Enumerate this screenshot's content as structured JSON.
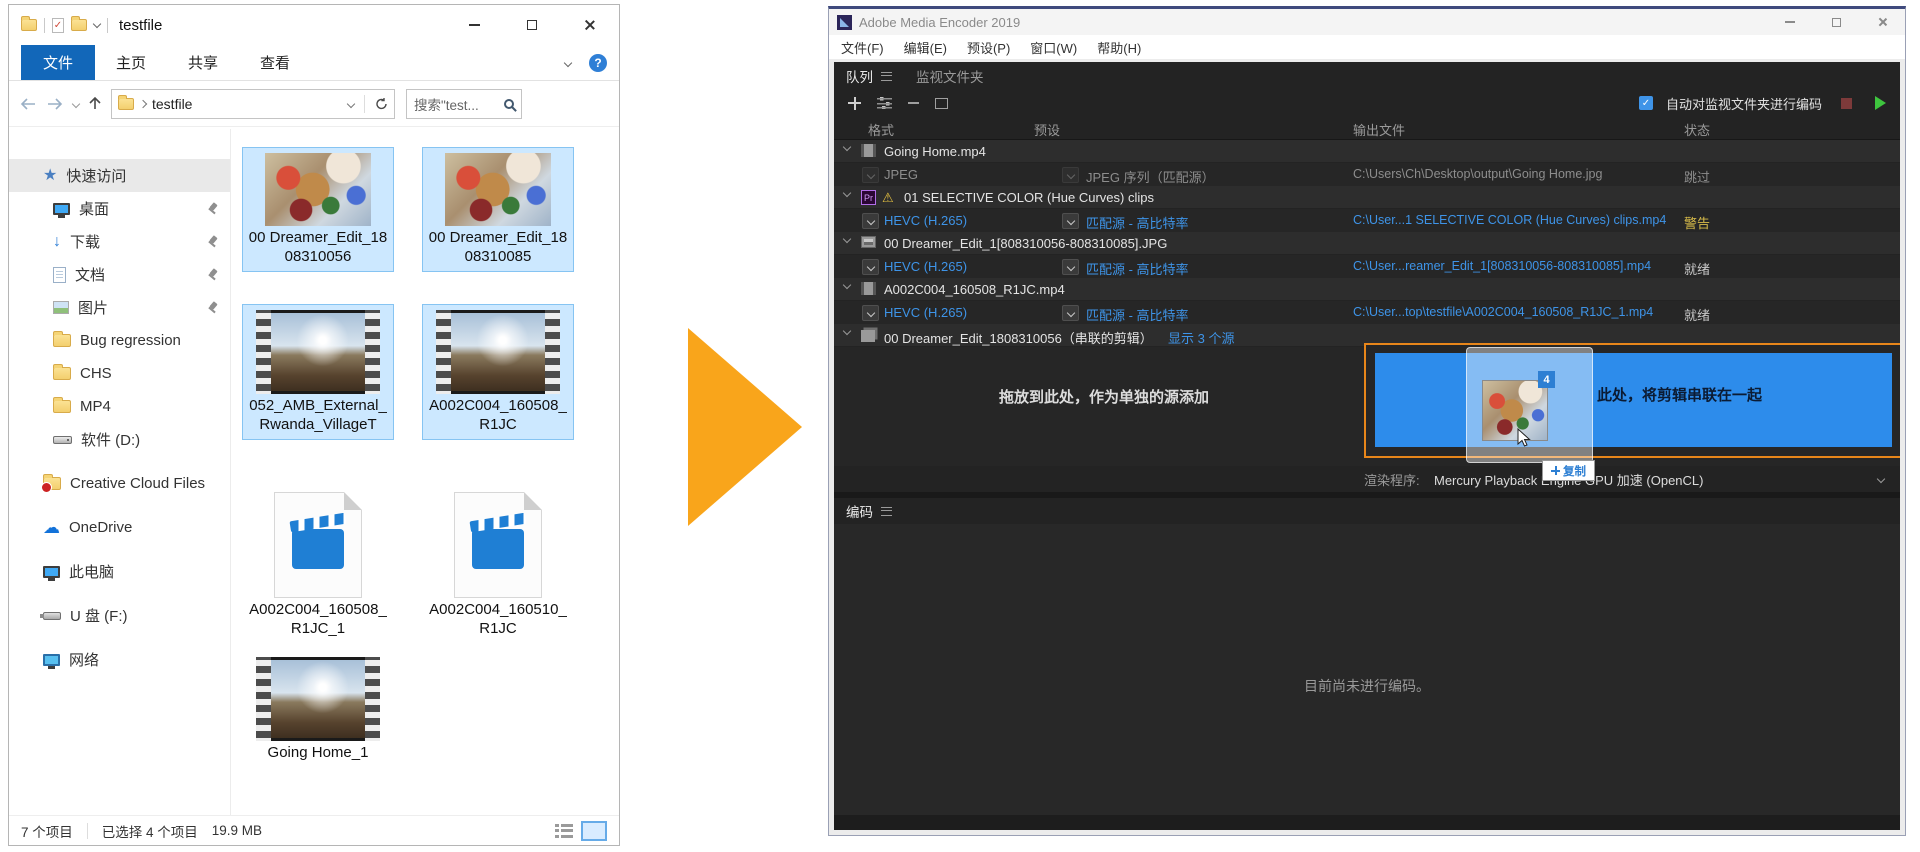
{
  "icons": {
    "star": "★",
    "download_arrow": "↓",
    "cloud": "☁",
    "warning": "⚠",
    "pr_badge": "Pr",
    "help": "?",
    "check": "✓",
    "red_check": "✓"
  },
  "explorer": {
    "title": "testfile",
    "ribbon_tabs": {
      "file": "文件",
      "home": "主页",
      "share": "共享",
      "view": "查看"
    },
    "nav": {
      "path": "testfile",
      "search_text": "搜索\"test..."
    },
    "sidebar": [
      {
        "label": "快速访问",
        "icon": "star"
      },
      {
        "label": "桌面",
        "icon": "desktop",
        "pinned": true
      },
      {
        "label": "下载",
        "icon": "download",
        "pinned": true
      },
      {
        "label": "文档",
        "icon": "document",
        "pinned": true
      },
      {
        "label": "图片",
        "icon": "picture",
        "pinned": true
      },
      {
        "label": "Bug regression",
        "icon": "folder"
      },
      {
        "label": "CHS",
        "icon": "folder"
      },
      {
        "label": "MP4",
        "icon": "folder"
      },
      {
        "label": "软件 (D:)",
        "icon": "drive"
      },
      {
        "label": "Creative Cloud Files",
        "icon": "cc-folder"
      },
      {
        "label": "OneDrive",
        "icon": "cloud"
      },
      {
        "label": "此电脑",
        "icon": "this-pc"
      },
      {
        "label": "U 盘 (F:)",
        "icon": "usb"
      },
      {
        "label": "网络",
        "icon": "network"
      }
    ],
    "files": [
      {
        "name": "00 Dreamer_Edit_1808310056",
        "kind": "image",
        "selected": true
      },
      {
        "name": "00 Dreamer_Edit_1808310085",
        "kind": "image",
        "selected": true
      },
      {
        "name": "052_AMB_External_Rwanda_VillageT",
        "kind": "filmstrip",
        "selected": true
      },
      {
        "name": "A002C004_160508_R1JC",
        "kind": "filmstrip",
        "selected": true
      },
      {
        "name": "A002C004_160508_R1JC_1",
        "kind": "video-doc",
        "selected": false
      },
      {
        "name": "A002C004_160510_R1JC",
        "kind": "video-doc",
        "selected": false
      },
      {
        "name": "Going Home_1",
        "kind": "filmstrip",
        "selected": false
      }
    ],
    "status_bar": {
      "items_count": "7 个项目",
      "selected_count": "已选择 4 个项目",
      "size": "19.9 MB"
    }
  },
  "arrow": {
    "color": "#F9A51B"
  },
  "ame": {
    "title": "Adobe Media Encoder 2019",
    "menu": {
      "file": "文件(F)",
      "edit": "编辑(E)",
      "preset": "预设(P)",
      "window": "窗口(W)",
      "help": "帮助(H)"
    },
    "tabs": {
      "queue": "队列",
      "watch_folders": "监视文件夹"
    },
    "toolbar": {
      "auto_encode_label": "自动对监视文件夹进行编码",
      "auto_encode_checked": true
    },
    "columns": {
      "format": "格式",
      "preset": "预设",
      "output_file": "输出文件",
      "status": "状态"
    },
    "queue": [
      {
        "type": "source",
        "name": "Going Home.mp4",
        "icon": "film"
      },
      {
        "type": "output",
        "format": "JPEG",
        "preset": "JPEG 序列（匹配源）",
        "file": "C:\\Users\\Ch\\Desktop\\output\\Going Home.jpg",
        "status": "跳过"
      },
      {
        "type": "source",
        "name": "01 SELECTIVE COLOR (Hue Curves) clips",
        "icon": "premiere",
        "warning": true
      },
      {
        "type": "output",
        "format": "HEVC (H.265)",
        "preset": "匹配源 - 高比特率",
        "file": "C:\\User...1 SELECTIVE COLOR (Hue Curves) clips.mp4",
        "status": "警告"
      },
      {
        "type": "source",
        "name": "00 Dreamer_Edit_1[808310056-808310085].JPG",
        "icon": "image"
      },
      {
        "type": "output",
        "format": "HEVC (H.265)",
        "preset": "匹配源 - 高比特率",
        "file": "C:\\User...reamer_Edit_1[808310056-808310085].mp4",
        "status": "就绪"
      },
      {
        "type": "source",
        "name": "A002C004_160508_R1JC.mp4",
        "icon": "film"
      },
      {
        "type": "output",
        "format": "HEVC (H.265)",
        "preset": "匹配源 - 高比特率",
        "file": "C:\\User...top\\testfile\\A002C004_160508_R1JC_1.mp4",
        "status": "就绪"
      },
      {
        "type": "source",
        "name": "00 Dreamer_Edit_1808310056（串联的剪辑）",
        "icon": "stack",
        "link": "显示 3 个源"
      }
    ],
    "drop_zone": {
      "left_hint": "拖放到此处，作为单独的源添加",
      "right_hint_visible": "此处，将剪辑串联在一起",
      "drag_count": "4",
      "drag_tooltip": "复制"
    },
    "renderer": {
      "label": "渲染程序:",
      "value": "Mercury Playback Engine GPU 加速 (OpenCL)"
    },
    "encoding": {
      "tab": "编码",
      "empty_message": "目前尚未进行编码。"
    },
    "colors": {
      "link_blue": "#3E94E8",
      "warning_yellow": "#D8BC4A",
      "drop_blue": "#2D8CEB",
      "drop_border_orange": "#E8861A",
      "play_green": "#3EC53E"
    }
  }
}
